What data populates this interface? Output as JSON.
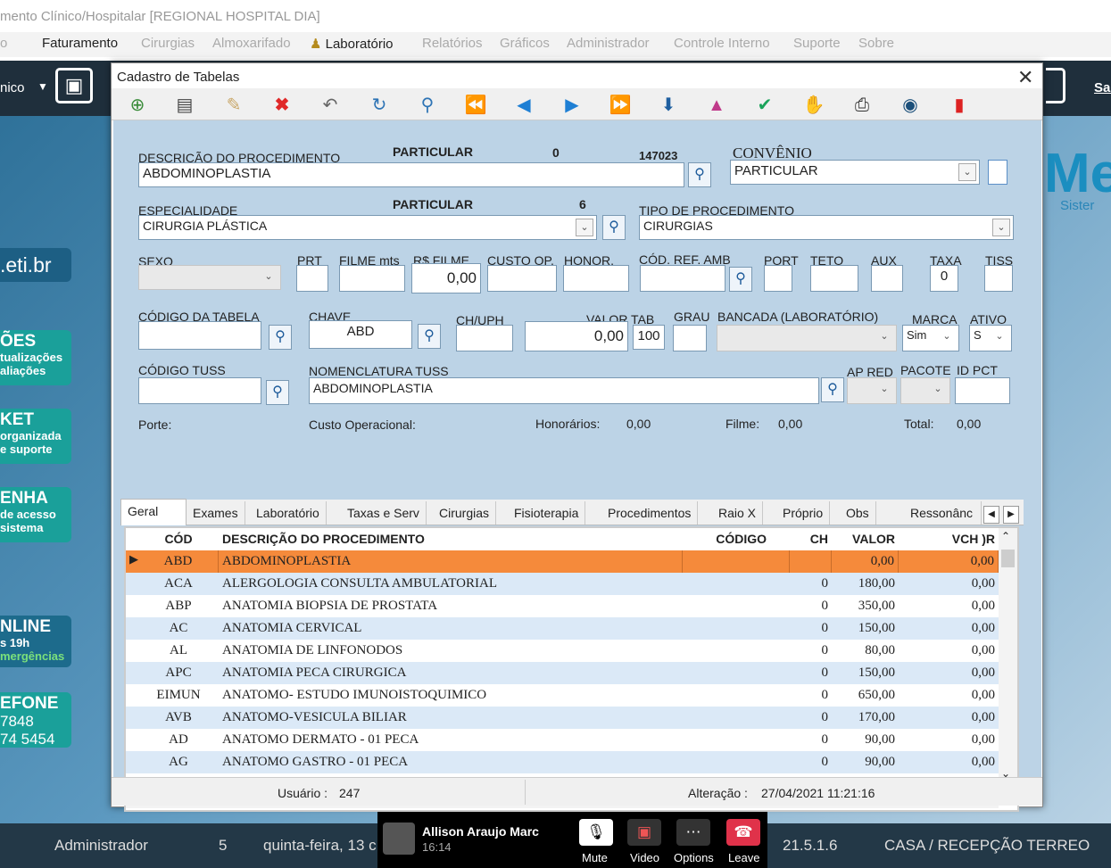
{
  "app_title": "mento Clínico/Hospitalar [REGIONAL HOSPITAL DIA]",
  "menu": {
    "items": [
      "o",
      "Faturamento",
      "Cirurgias",
      "Almoxarifado",
      "Laboratório",
      "Relatórios",
      "Gráficos",
      "Administrador",
      "Controle Interno",
      "Suporte",
      "Sobre"
    ]
  },
  "background": {
    "inicio": "nico",
    "sai": "Sai",
    "site": ".eti.br",
    "logo": "Me",
    "logo_sub": "Sister",
    "cards": [
      {
        "t1": "ÕES",
        "t2a": "tualizações",
        "t2b": "aliações"
      },
      {
        "t1": "KET",
        "t2a": "organizada",
        "t2b": "e suporte"
      },
      {
        "t1": "ENHA",
        "t2a": "de acesso",
        "t2b": "sistema"
      },
      {
        "t1": "NLINE",
        "t2a": "s 19h",
        "t2b": "mergências"
      },
      {
        "t1": "EFONE",
        "t2a": "7848",
        "t2b": "74 5454"
      }
    ]
  },
  "window": {
    "title": "Cadastro de Tabelas"
  },
  "toolbar": {
    "icons": [
      "new-icon",
      "save-icon",
      "edit-icon",
      "delete-icon",
      "undo-icon",
      "refresh-icon",
      "search-icon",
      "first-icon",
      "prev-icon",
      "next-icon",
      "last-icon",
      "download-icon",
      "lab-flask-icon",
      "confirm-icon",
      "hand-icon",
      "print-icon",
      "globe-icon",
      "exit-icon"
    ]
  },
  "form": {
    "descricao_label": "DESCRIÇÃO DO PROCEDIMENTO",
    "descricao_value": "ABDOMINOPLASTIA",
    "particular1": "PARTICULAR",
    "zero": "0",
    "code_147023": "147023",
    "convenio_label": "CONVÊNIO",
    "convenio_value": "PARTICULAR",
    "especialidade_label": "ESPECIALIDADE",
    "especialidade_value": "CIRURGIA PLÁSTICA",
    "particular2": "PARTICULAR",
    "six": "6",
    "tipo_label": "TIPO DE PROCEDIMENTO",
    "tipo_value": "CIRURGIAS",
    "sexo_label": "SEXO",
    "prt_label": "PRT",
    "filme_mts_label": "FILME mts",
    "rs_filme_label": "R$ FILME",
    "rs_filme_value": "0,00",
    "custo_op_label": "CUSTO OP.",
    "honor_label": "HONOR.",
    "cod_ref_label": "CÓD. REF. AMB",
    "port_label": "PORT",
    "teto_label": "TETO",
    "aux_label": "AUX",
    "taxa_label": "TAXA",
    "taxa_value": "0",
    "tiss_label": "TISS",
    "codigo_tabela_label": "CÓDIGO DA TABELA",
    "chave_label": "CHAVE",
    "chave_value": "ABD",
    "ch_uph_label": "CH/UPH",
    "valor_tab_label": "VALOR TAB",
    "valor_tab_value": "0,00",
    "valor_tab_pct": "100",
    "grau_label": "GRAU",
    "bancada_label": "BANCADA (LABORATÓRIO)",
    "marca_label": "MARCA",
    "marca_value": "Sim",
    "ativo_label": "ATIVO",
    "ativo_value": "S",
    "tuss_label": "CÓDIGO TUSS",
    "nomenclatura_label": "NOMENCLATURA TUSS",
    "nomenclatura_value": "ABDOMINOPLASTIA",
    "ap_red_label": "AP RED",
    "pacote_label": "PACOTE",
    "id_pct_label": "ID PCT",
    "porte_label": "Porte:",
    "custo_operacional_label": "Custo Operacional:",
    "honorarios_label": "Honorários:",
    "honorarios_value": "0,00",
    "filme_label": "Filme:",
    "filme_value": "0,00",
    "total_label": "Total:",
    "total_value": "0,00"
  },
  "tabs": [
    "Geral",
    "Exames",
    "Laboratório",
    "Taxas e Serv",
    "Cirurgias",
    "Fisioterapia",
    "Procedimentos",
    "Raio X",
    "Próprio",
    "Obs",
    "Ressonânc"
  ],
  "grid": {
    "headers": [
      "CÓD",
      "DESCRIÇÃO DO PROCEDIMENTO",
      "CÓDIGO",
      "CH",
      "VALOR",
      "VCH )R"
    ],
    "rows": [
      [
        "ABD",
        "ABDOMINOPLASTIA",
        "",
        "",
        "0,00",
        "0,00"
      ],
      [
        "ACA",
        "ALERGOLOGIA CONSULTA AMBULATORIAL",
        "",
        "0",
        "180,00",
        "0,00"
      ],
      [
        "ABP",
        "ANATOMIA BIOPSIA DE PROSTATA",
        "",
        "0",
        "350,00",
        "0,00"
      ],
      [
        "AC",
        "ANATOMIA CERVICAL",
        "",
        "0",
        "150,00",
        "0,00"
      ],
      [
        "AL",
        "ANATOMIA DE LINFONODOS",
        "",
        "0",
        "80,00",
        "0,00"
      ],
      [
        "APC",
        "ANATOMIA PECA CIRURGICA",
        "",
        "0",
        "150,00",
        "0,00"
      ],
      [
        "EIMUN",
        "ANATOMO- ESTUDO IMUNOISTOQUIMICO",
        "",
        "0",
        "650,00",
        "0,00"
      ],
      [
        "AVB",
        "ANATOMO-VESICULA BILIAR",
        "",
        "0",
        "170,00",
        "0,00"
      ],
      [
        "AD",
        "ANATOMO DERMATO - 01 PECA",
        "",
        "0",
        "90,00",
        "0,00"
      ],
      [
        "AG",
        "ANATOMO GASTRO - 01 PECA",
        "",
        "0",
        "90,00",
        "0,00"
      ]
    ]
  },
  "status": {
    "usuario_label": "Usuário :",
    "usuario_value": "247",
    "alteracao_label": "Alteração :",
    "alteracao_value": "27/04/2021 11:21:16"
  },
  "taskbar": {
    "user": "Administrador",
    "num": "5",
    "date": "quinta-feira, 13 c",
    "version": "21.5.1.6",
    "location": "CASA / RECEPÇÃO TERREO"
  },
  "call": {
    "name": "Allison Araujo Marc",
    "time": "16:14",
    "mute": "Mute",
    "video": "Video",
    "options": "Options",
    "leave": "Leave"
  }
}
